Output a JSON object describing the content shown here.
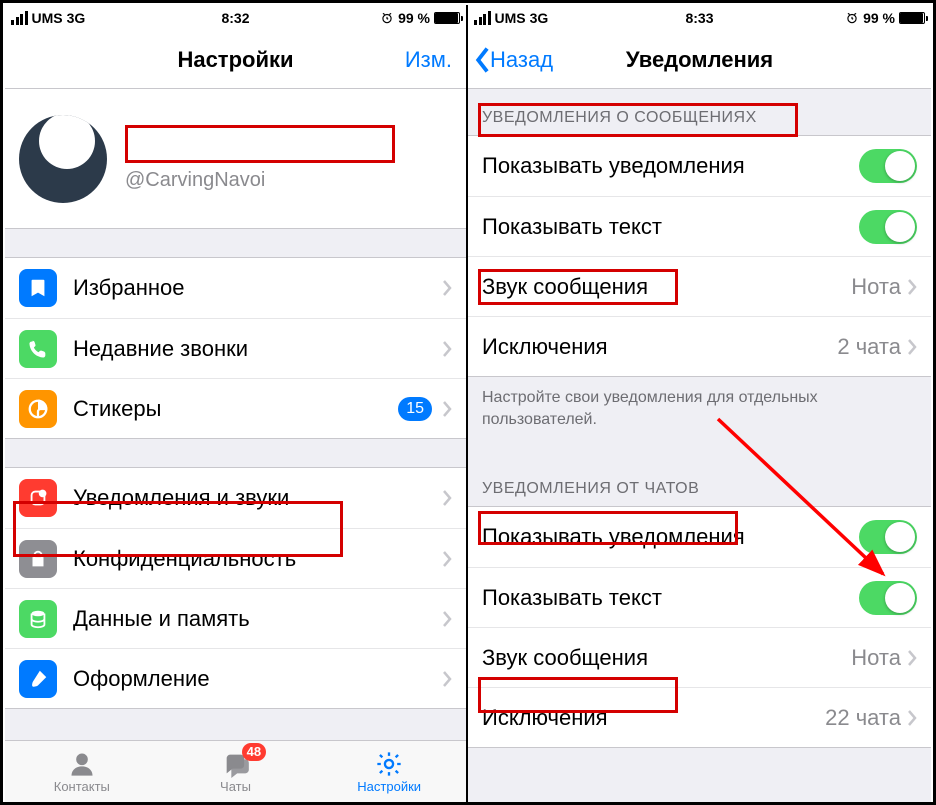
{
  "status": {
    "carrier": "UMS",
    "network": "3G",
    "time_left": "8:32",
    "time_right": "8:33",
    "battery": "99 %"
  },
  "left": {
    "title": "Настройки",
    "edit": "Изм.",
    "profile": {
      "username": "@CarvingNavoi"
    },
    "rows1": {
      "fav": "Избранное",
      "calls": "Недавние звонки",
      "stickers": "Стикеры",
      "stickers_badge": "15"
    },
    "rows2": {
      "notif": "Уведомления и звуки",
      "privacy": "Конфиденциальность",
      "data": "Данные и память",
      "appearance": "Оформление"
    },
    "tabs": {
      "contacts": "Контакты",
      "chats": "Чаты",
      "chats_badge": "48",
      "settings": "Настройки"
    }
  },
  "right": {
    "back": "Назад",
    "title": "Уведомления",
    "section1": "УВЕДОМЛЕНИЯ О СООБЩЕНИЯХ",
    "section2": "УВЕДОМЛЕНИЯ ОТ ЧАТОВ",
    "rows": {
      "show_notif": "Показывать уведомления",
      "show_text": "Показывать текст",
      "sound": "Звук сообщения",
      "sound_value": "Нота",
      "exceptions": "Исключения",
      "exc_val1": "2 чата",
      "exc_val2": "22 чата"
    },
    "footer": "Настройте свои уведомления для отдельных пользователей."
  }
}
